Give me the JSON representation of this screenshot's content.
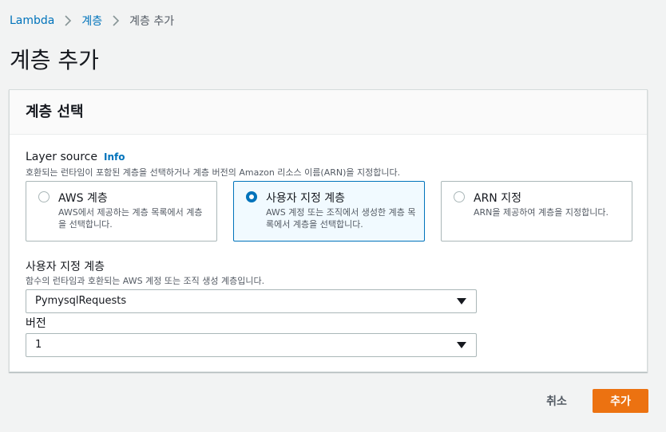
{
  "breadcrumb": {
    "items": [
      "Lambda",
      "계층",
      "계층 추가"
    ]
  },
  "page": {
    "title": "계층 추가"
  },
  "panel": {
    "title": "계층 선택"
  },
  "layer_source": {
    "label": "Layer source",
    "info": "Info",
    "description": "호환되는 런타임이 포함된 계층을 선택하거나 계층 버전의 Amazon 리소스 이름(ARN)을 지정합니다.",
    "options": [
      {
        "title": "AWS 계층",
        "desc": "AWS에서 제공하는 계층 목록에서 계층을 선택합니다.",
        "selected": false
      },
      {
        "title": "사용자 지정 계층",
        "desc": "AWS 계정 또는 조직에서 생성한 계층 목록에서 계층을 선택합니다.",
        "selected": true
      },
      {
        "title": "ARN 지정",
        "desc": "ARN을 제공하여 계층을 지정합니다.",
        "selected": false
      }
    ]
  },
  "custom_layer": {
    "label": "사용자 지정 계층",
    "description": "함수의 런타임과 호환되는 AWS 계정 또는 조직 생성 계층입니다.",
    "value": "PymysqlRequests"
  },
  "version": {
    "label": "버전",
    "value": "1"
  },
  "actions": {
    "cancel": "취소",
    "add": "추가"
  },
  "colors": {
    "link": "#0073bb",
    "primary": "#ec7211",
    "selected_border": "#0073bb",
    "selected_bg": "#f1faff"
  },
  "icons": {
    "separator": "chevron-right-icon",
    "dropdown": "caret-down-icon"
  }
}
